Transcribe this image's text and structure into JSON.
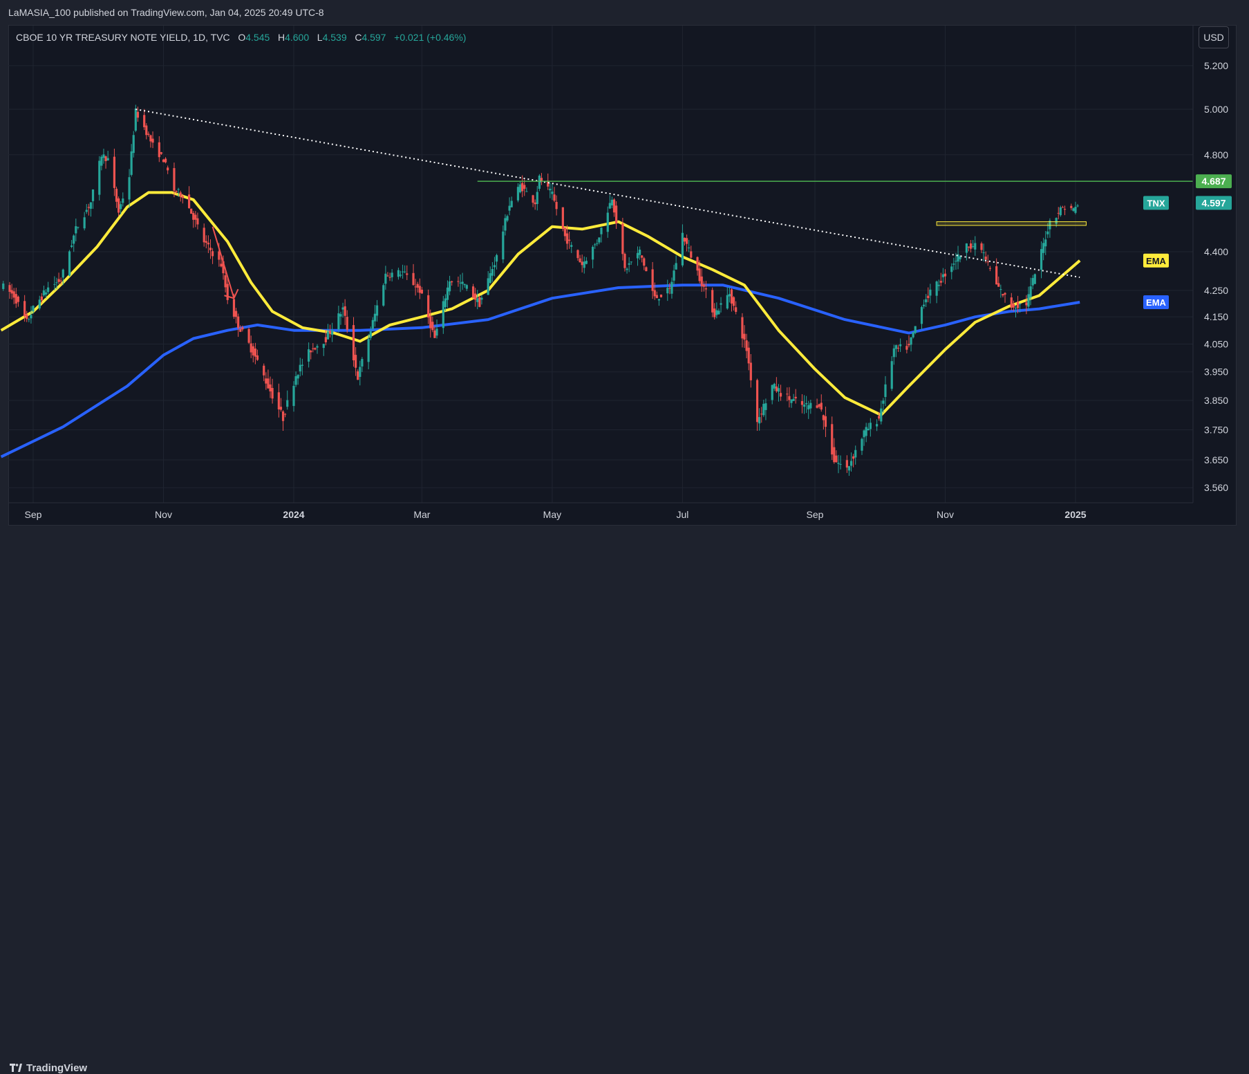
{
  "header": {
    "publisher_line": "LaMASIA_100 published on TradingView.com, Jan 04, 2025 20:49 UTC-8"
  },
  "symbol": {
    "name": "CBOE 10 YR TREASURY NOTE YIELD, 1D, TVC",
    "open_label": "O",
    "open": "4.545",
    "high_label": "H",
    "high": "4.600",
    "low_label": "L",
    "low": "4.539",
    "close_label": "C",
    "close": "4.597",
    "change": "+0.021 (+0.46%)"
  },
  "currency_button": "USD",
  "footer": {
    "brand": "TradingView"
  },
  "colors": {
    "up": "#26a69a",
    "down": "#ef5350",
    "ema_fast": "#ffeb3b",
    "ema_slow": "#2962ff",
    "resistance": "#4caf50",
    "zone": "#ffeb3b"
  },
  "chart_data": {
    "type": "candlestick",
    "y_axis": {
      "ticks": [
        "5.200",
        "5.000",
        "4.800",
        "4.400",
        "4.250",
        "4.150",
        "4.050",
        "3.950",
        "3.850",
        "3.750",
        "3.650",
        "3.560"
      ],
      "scale": "log"
    },
    "x_axis": {
      "ticks": [
        {
          "label": "Sep",
          "date": "2023-09-01",
          "bold": false
        },
        {
          "label": "Nov",
          "date": "2023-11-01",
          "bold": false
        },
        {
          "label": "2024",
          "date": "2024-01-01",
          "bold": true
        },
        {
          "label": "Mar",
          "date": "2024-03-01",
          "bold": false
        },
        {
          "label": "May",
          "date": "2024-05-01",
          "bold": false
        },
        {
          "label": "Jul",
          "date": "2024-07-01",
          "bold": false
        },
        {
          "label": "Sep",
          "date": "2024-09-01",
          "bold": false
        },
        {
          "label": "Nov",
          "date": "2024-11-01",
          "bold": false
        },
        {
          "label": "2025",
          "date": "2025-01-01",
          "bold": true
        }
      ]
    },
    "price_labels": [
      {
        "text": "4.687",
        "value": 4.687,
        "color": "#4caf50"
      },
      {
        "name": "TNX",
        "text": "4.597",
        "value": 4.597,
        "color": "#26a69a"
      },
      {
        "name": "EMA",
        "value": 4.365,
        "color": "#ffeb3b"
      },
      {
        "name": "EMA",
        "value": 4.205,
        "color": "#2962ff"
      }
    ],
    "price_path": [
      [
        "2023-08-17",
        4.27
      ],
      [
        "2023-08-23",
        4.23
      ],
      [
        "2023-08-29",
        4.13
      ],
      [
        "2023-09-01",
        4.18
      ],
      [
        "2023-09-08",
        4.26
      ],
      [
        "2023-09-14",
        4.29
      ],
      [
        "2023-09-21",
        4.49
      ],
      [
        "2023-09-28",
        4.6
      ],
      [
        "2023-10-03",
        4.8
      ],
      [
        "2023-10-06",
        4.78
      ],
      [
        "2023-10-11",
        4.56
      ],
      [
        "2023-10-16",
        4.71
      ],
      [
        "2023-10-19",
        4.99
      ],
      [
        "2023-10-23",
        4.92
      ],
      [
        "2023-10-27",
        4.84
      ],
      [
        "2023-11-01",
        4.78
      ],
      [
        "2023-11-06",
        4.65
      ],
      [
        "2023-11-10",
        4.63
      ],
      [
        "2023-11-15",
        4.54
      ],
      [
        "2023-11-20",
        4.44
      ],
      [
        "2023-11-28",
        4.35
      ],
      [
        "2023-12-01",
        4.22
      ],
      [
        "2023-12-06",
        4.12
      ],
      [
        "2023-12-13",
        4.02
      ],
      [
        "2023-12-20",
        3.9
      ],
      [
        "2023-12-27",
        3.79
      ],
      [
        "2024-01-02",
        3.94
      ],
      [
        "2024-01-09",
        4.03
      ],
      [
        "2024-01-16",
        4.07
      ],
      [
        "2024-01-24",
        4.18
      ],
      [
        "2024-01-31",
        3.93
      ],
      [
        "2024-02-06",
        4.1
      ],
      [
        "2024-02-13",
        4.31
      ],
      [
        "2024-02-21",
        4.32
      ],
      [
        "2024-02-29",
        4.25
      ],
      [
        "2024-03-07",
        4.07
      ],
      [
        "2024-03-14",
        4.29
      ],
      [
        "2024-03-21",
        4.27
      ],
      [
        "2024-03-28",
        4.2
      ],
      [
        "2024-04-05",
        4.38
      ],
      [
        "2024-04-11",
        4.59
      ],
      [
        "2024-04-16",
        4.67
      ],
      [
        "2024-04-23",
        4.6
      ],
      [
        "2024-04-25",
        4.7
      ],
      [
        "2024-05-01",
        4.63
      ],
      [
        "2024-05-07",
        4.46
      ],
      [
        "2024-05-15",
        4.35
      ],
      [
        "2024-05-22",
        4.44
      ],
      [
        "2024-05-29",
        4.62
      ],
      [
        "2024-06-04",
        4.33
      ],
      [
        "2024-06-11",
        4.4
      ],
      [
        "2024-06-18",
        4.22
      ],
      [
        "2024-06-25",
        4.25
      ],
      [
        "2024-07-01",
        4.47
      ],
      [
        "2024-07-09",
        4.3
      ],
      [
        "2024-07-16",
        4.16
      ],
      [
        "2024-07-23",
        4.24
      ],
      [
        "2024-07-31",
        4.03
      ],
      [
        "2024-08-05",
        3.78
      ],
      [
        "2024-08-12",
        3.9
      ],
      [
        "2024-08-19",
        3.86
      ],
      [
        "2024-08-27",
        3.83
      ],
      [
        "2024-09-03",
        3.84
      ],
      [
        "2024-09-10",
        3.65
      ],
      [
        "2024-09-16",
        3.62
      ],
      [
        "2024-09-24",
        3.74
      ],
      [
        "2024-10-01",
        3.79
      ],
      [
        "2024-10-08",
        4.03
      ],
      [
        "2024-10-15",
        4.04
      ],
      [
        "2024-10-22",
        4.21
      ],
      [
        "2024-10-29",
        4.28
      ],
      [
        "2024-11-05",
        4.36
      ],
      [
        "2024-11-12",
        4.43
      ],
      [
        "2024-11-18",
        4.41
      ],
      [
        "2024-11-25",
        4.27
      ],
      [
        "2024-12-02",
        4.19
      ],
      [
        "2024-12-09",
        4.2
      ],
      [
        "2024-12-16",
        4.4
      ],
      [
        "2024-12-20",
        4.52
      ],
      [
        "2024-12-26",
        4.58
      ],
      [
        "2024-12-31",
        4.57
      ],
      [
        "2025-01-03",
        4.597
      ]
    ],
    "last_candle": {
      "open": 4.545,
      "high": 4.6,
      "low": 4.539,
      "close": 4.597
    },
    "ema_fast": [
      [
        "2023-08-17",
        4.1
      ],
      [
        "2023-09-01",
        4.17
      ],
      [
        "2023-09-15",
        4.28
      ],
      [
        "2023-10-01",
        4.42
      ],
      [
        "2023-10-15",
        4.58
      ],
      [
        "2023-10-25",
        4.64
      ],
      [
        "2023-11-05",
        4.64
      ],
      [
        "2023-11-15",
        4.61
      ],
      [
        "2023-12-01",
        4.44
      ],
      [
        "2023-12-12",
        4.28
      ],
      [
        "2023-12-22",
        4.17
      ],
      [
        "2024-01-05",
        4.11
      ],
      [
        "2024-01-20",
        4.09
      ],
      [
        "2024-02-01",
        4.06
      ],
      [
        "2024-02-15",
        4.12
      ],
      [
        "2024-03-01",
        4.15
      ],
      [
        "2024-03-15",
        4.18
      ],
      [
        "2024-04-01",
        4.25
      ],
      [
        "2024-04-15",
        4.39
      ],
      [
        "2024-05-01",
        4.5
      ],
      [
        "2024-05-15",
        4.49
      ],
      [
        "2024-06-01",
        4.52
      ],
      [
        "2024-06-15",
        4.46
      ],
      [
        "2024-07-01",
        4.38
      ],
      [
        "2024-07-15",
        4.33
      ],
      [
        "2024-07-30",
        4.27
      ],
      [
        "2024-08-15",
        4.1
      ],
      [
        "2024-09-01",
        3.96
      ],
      [
        "2024-09-15",
        3.86
      ],
      [
        "2024-10-02",
        3.8
      ],
      [
        "2024-10-15",
        3.9
      ],
      [
        "2024-11-01",
        4.03
      ],
      [
        "2024-11-15",
        4.13
      ],
      [
        "2024-12-01",
        4.19
      ],
      [
        "2024-12-15",
        4.23
      ],
      [
        "2025-01-03",
        4.365
      ]
    ],
    "ema_slow": [
      [
        "2023-08-17",
        3.66
      ],
      [
        "2023-09-15",
        3.76
      ],
      [
        "2023-10-15",
        3.9
      ],
      [
        "2023-11-01",
        4.01
      ],
      [
        "2023-11-15",
        4.07
      ],
      [
        "2023-12-01",
        4.1
      ],
      [
        "2023-12-15",
        4.12
      ],
      [
        "2024-01-01",
        4.1
      ],
      [
        "2024-02-01",
        4.1
      ],
      [
        "2024-03-01",
        4.11
      ],
      [
        "2024-04-01",
        4.14
      ],
      [
        "2024-05-01",
        4.22
      ],
      [
        "2024-06-01",
        4.26
      ],
      [
        "2024-07-01",
        4.27
      ],
      [
        "2024-07-20",
        4.27
      ],
      [
        "2024-08-15",
        4.22
      ],
      [
        "2024-09-15",
        4.14
      ],
      [
        "2024-10-15",
        4.09
      ],
      [
        "2024-11-01",
        4.12
      ],
      [
        "2024-11-15",
        4.15
      ],
      [
        "2024-12-01",
        4.17
      ],
      [
        "2024-12-15",
        4.18
      ],
      [
        "2025-01-03",
        4.205
      ]
    ],
    "annotations": [
      {
        "kind": "trendline",
        "style": "dotted",
        "from": [
          "2023-10-19",
          5.0
        ],
        "to": [
          "2025-01-03",
          4.3
        ]
      },
      {
        "kind": "hline",
        "from_date": "2024-03-27",
        "to_date": "2025-01-03",
        "value": 4.687
      },
      {
        "kind": "zone",
        "from_date": "2024-10-28",
        "to_date": "2025-01-06",
        "top": 4.52,
        "bottom": 4.505
      },
      {
        "kind": "arrow",
        "from": [
          "2023-11-24",
          4.5
        ],
        "to": [
          "2023-12-04",
          4.22
        ]
      }
    ]
  }
}
